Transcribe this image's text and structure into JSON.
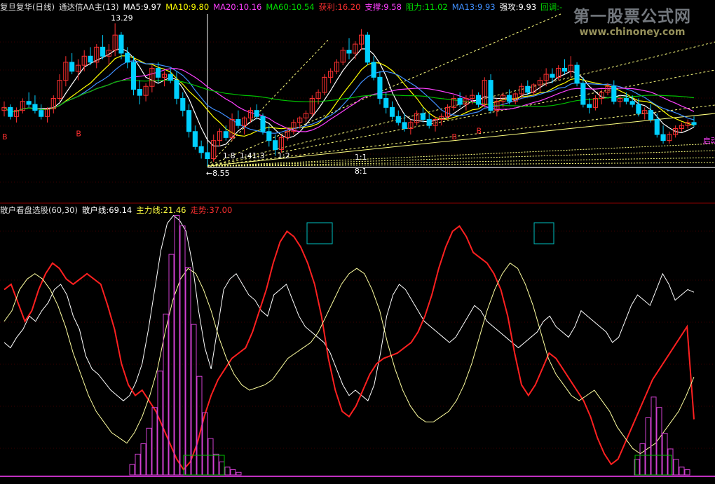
{
  "header_top": {
    "stock": "复旦复华(日线)",
    "indicator": "通达信AA主(13)",
    "ma5": "MA5:9.97",
    "ma10": "MA10:9.80",
    "ma20": "MA20:10.16",
    "ma60": "MA60:10.54",
    "profit": "获利:16.20",
    "support": "支撑:9.58",
    "resist": "阻力:11.02",
    "ma13": "MA13:9.93",
    "strong": "强攻:9.93",
    "pullback": "回调:-"
  },
  "header_bottom": {
    "name": "散户看盘选股(60,30)",
    "retail": "散户线:69.14",
    "main": "主力线:21.46",
    "trend": "走势:37.00"
  },
  "watermark": {
    "cn": "第一股票公式网",
    "url": "www.chinoney.com"
  },
  "colors": {
    "up": "#ff3030",
    "down": "#00d0ff",
    "yellow": "#ffff40",
    "ma5": "#ffffff",
    "ma10": "#ffff00",
    "ma20": "#ff40ff",
    "ma60": "#00c000",
    "retail": "#ffffff",
    "main": "#ff2020",
    "trend": "#ffffa0",
    "bar": "#d040d0",
    "box": "#00c0c0",
    "grid": "#8b0000"
  },
  "chart_data": [
    {
      "type": "candlestick",
      "title": "复旦复华(日线)",
      "ylim": [
        8.3,
        13.6
      ],
      "annotations": {
        "high": "13.29",
        "low": "8.55",
        "start_label": "启动",
        "b_label": "B"
      },
      "fib_labels": [
        "1:8",
        "1:4",
        "1:3",
        "1:2",
        "1:1",
        "8:1"
      ],
      "ohlc": [
        [
          10.4,
          10.7,
          10.2,
          10.5
        ],
        [
          10.5,
          10.6,
          10.1,
          10.2
        ],
        [
          10.2,
          10.5,
          10.0,
          10.4
        ],
        [
          10.4,
          10.8,
          10.3,
          10.7
        ],
        [
          10.7,
          11.0,
          10.5,
          10.6
        ],
        [
          10.6,
          10.9,
          10.3,
          10.4
        ],
        [
          10.4,
          10.6,
          10.1,
          10.2
        ],
        [
          10.2,
          10.5,
          10.0,
          10.45
        ],
        [
          10.45,
          10.9,
          10.3,
          10.8
        ],
        [
          10.8,
          11.6,
          10.7,
          11.4
        ],
        [
          11.4,
          12.2,
          11.2,
          12.0
        ],
        [
          12.0,
          12.3,
          11.6,
          11.7
        ],
        [
          11.7,
          12.1,
          11.4,
          11.9
        ],
        [
          11.9,
          12.4,
          11.7,
          12.2
        ],
        [
          12.2,
          12.5,
          11.9,
          12.0
        ],
        [
          12.0,
          12.6,
          11.8,
          12.5
        ],
        [
          12.5,
          12.9,
          12.1,
          12.2
        ],
        [
          12.2,
          12.6,
          11.9,
          12.4
        ],
        [
          12.4,
          13.29,
          12.2,
          12.9
        ],
        [
          12.9,
          13.0,
          12.1,
          12.3
        ],
        [
          12.3,
          12.5,
          11.8,
          12.0
        ],
        [
          12.0,
          12.2,
          10.9,
          11.1
        ],
        [
          11.1,
          11.4,
          10.6,
          10.9
        ],
        [
          10.9,
          11.3,
          10.7,
          11.2
        ],
        [
          11.2,
          11.9,
          11.0,
          11.8
        ],
        [
          11.8,
          12.0,
          11.3,
          11.5
        ],
        [
          11.5,
          11.7,
          11.2,
          11.6
        ],
        [
          11.6,
          11.8,
          11.3,
          11.4
        ],
        [
          11.4,
          11.7,
          10.6,
          10.8
        ],
        [
          10.8,
          11.0,
          10.2,
          10.4
        ],
        [
          10.4,
          10.6,
          9.5,
          9.7
        ],
        [
          9.7,
          9.9,
          9.1,
          9.2
        ],
        [
          9.2,
          9.4,
          8.8,
          9.0
        ],
        [
          9.0,
          9.3,
          8.55,
          8.8
        ],
        [
          8.8,
          9.6,
          8.7,
          9.4
        ],
        [
          9.4,
          9.8,
          9.2,
          9.7
        ],
        [
          9.7,
          9.9,
          9.4,
          9.5
        ],
        [
          9.5,
          10.3,
          9.4,
          10.1
        ],
        [
          10.1,
          10.4,
          9.8,
          9.9
        ],
        [
          9.9,
          10.2,
          9.6,
          10.15
        ],
        [
          10.15,
          10.5,
          10.0,
          10.4
        ],
        [
          10.4,
          10.6,
          10.1,
          10.2
        ],
        [
          10.2,
          10.3,
          9.6,
          9.7
        ],
        [
          9.7,
          9.9,
          9.2,
          9.4
        ],
        [
          9.4,
          9.6,
          8.9,
          9.1
        ],
        [
          9.1,
          9.6,
          9.0,
          9.5
        ],
        [
          9.5,
          9.8,
          9.4,
          9.7
        ],
        [
          9.7,
          10.1,
          9.6,
          10.0
        ],
        [
          10.0,
          10.2,
          9.8,
          10.15
        ],
        [
          10.15,
          10.4,
          10.0,
          10.3
        ],
        [
          10.3,
          10.9,
          10.2,
          10.8
        ],
        [
          10.8,
          11.1,
          10.6,
          11.0
        ],
        [
          11.0,
          11.6,
          10.9,
          11.5
        ],
        [
          11.5,
          11.8,
          11.3,
          11.7
        ],
        [
          11.7,
          12.1,
          11.6,
          12.0
        ],
        [
          12.0,
          12.5,
          11.9,
          12.4
        ],
        [
          12.4,
          12.8,
          12.1,
          12.3
        ],
        [
          12.3,
          12.7,
          12.1,
          12.6
        ],
        [
          12.6,
          13.1,
          12.4,
          12.9
        ],
        [
          12.9,
          13.0,
          11.9,
          12.0
        ],
        [
          12.0,
          12.2,
          11.4,
          11.5
        ],
        [
          11.5,
          11.7,
          10.6,
          10.8
        ],
        [
          10.8,
          11.0,
          10.3,
          10.5
        ],
        [
          10.5,
          10.7,
          10.1,
          10.2
        ],
        [
          10.2,
          10.4,
          9.9,
          10.0
        ],
        [
          10.0,
          10.3,
          9.7,
          9.8
        ],
        [
          9.8,
          10.1,
          9.6,
          10.0
        ],
        [
          10.0,
          10.4,
          9.9,
          10.3
        ],
        [
          10.3,
          10.5,
          10.0,
          10.1
        ],
        [
          10.1,
          10.3,
          9.8,
          9.9
        ],
        [
          9.9,
          10.2,
          9.7,
          10.1
        ],
        [
          10.1,
          10.3,
          9.9,
          10.2
        ],
        [
          10.2,
          10.6,
          10.1,
          10.5
        ],
        [
          10.5,
          10.9,
          10.4,
          10.8
        ],
        [
          10.8,
          11.0,
          10.5,
          10.6
        ],
        [
          10.6,
          10.9,
          10.4,
          10.8
        ],
        [
          10.8,
          11.1,
          10.6,
          10.9
        ],
        [
          10.9,
          11.0,
          10.5,
          10.6
        ],
        [
          10.6,
          11.5,
          10.5,
          11.4
        ],
        [
          11.4,
          11.6,
          10.3,
          10.4
        ],
        [
          10.4,
          10.8,
          10.2,
          10.7
        ],
        [
          10.7,
          11.0,
          10.5,
          10.9
        ],
        [
          10.9,
          11.1,
          10.6,
          10.7
        ],
        [
          10.7,
          11.0,
          10.6,
          10.95
        ],
        [
          10.95,
          11.3,
          10.8,
          11.2
        ],
        [
          11.2,
          11.4,
          10.9,
          11.0
        ],
        [
          11.0,
          11.3,
          10.9,
          11.25
        ],
        [
          11.25,
          11.5,
          11.0,
          11.4
        ],
        [
          11.4,
          11.8,
          11.2,
          11.6
        ],
        [
          11.6,
          11.8,
          11.3,
          11.5
        ],
        [
          11.5,
          11.9,
          11.4,
          11.8
        ],
        [
          11.8,
          12.1,
          11.6,
          11.7
        ],
        [
          11.7,
          12.2,
          11.5,
          11.9
        ],
        [
          11.9,
          12.0,
          11.2,
          11.3
        ],
        [
          11.3,
          11.5,
          10.5,
          10.6
        ],
        [
          10.6,
          10.8,
          10.3,
          10.5
        ],
        [
          10.5,
          10.9,
          10.4,
          10.8
        ],
        [
          10.8,
          11.1,
          10.6,
          11.0
        ],
        [
          11.0,
          11.3,
          10.9,
          11.2
        ],
        [
          11.2,
          11.4,
          10.6,
          10.7
        ],
        [
          10.7,
          10.9,
          10.5,
          10.8
        ],
        [
          10.8,
          11.0,
          10.6,
          10.7
        ],
        [
          10.7,
          10.9,
          10.5,
          10.6
        ],
        [
          10.6,
          10.8,
          10.2,
          10.3
        ],
        [
          10.3,
          10.5,
          10.1,
          10.4
        ],
        [
          10.4,
          10.6,
          10.0,
          10.1
        ],
        [
          10.1,
          10.3,
          9.5,
          9.6
        ],
        [
          9.6,
          9.9,
          9.3,
          9.4
        ],
        [
          9.4,
          9.7,
          9.3,
          9.6
        ],
        [
          9.6,
          9.9,
          9.5,
          9.8
        ],
        [
          9.8,
          10.0,
          9.7,
          9.9
        ],
        [
          9.9,
          10.1,
          9.8,
          10.0
        ],
        [
          10.0,
          10.2,
          9.85,
          9.93
        ]
      ]
    },
    {
      "type": "line",
      "title": "散户看盘选股(60,30)",
      "ylim": [
        0,
        100
      ],
      "series": [
        {
          "name": "散户线",
          "values": [
            50,
            48,
            52,
            55,
            60,
            58,
            62,
            65,
            70,
            72,
            68,
            60,
            55,
            45,
            40,
            38,
            35,
            32,
            30,
            28,
            30,
            35,
            42,
            55,
            70,
            85,
            95,
            98,
            96,
            92,
            80,
            62,
            48,
            40,
            55,
            70,
            74,
            76,
            72,
            68,
            66,
            62,
            60,
            68,
            70,
            72,
            66,
            60,
            56,
            54,
            52,
            50,
            46,
            40,
            34,
            30,
            32,
            30,
            28,
            34,
            46,
            60,
            68,
            72,
            70,
            66,
            62,
            58,
            56,
            54,
            52,
            50,
            52,
            56,
            60,
            64,
            62,
            58,
            56,
            54,
            52,
            50,
            48,
            50,
            52,
            54,
            58,
            60,
            56,
            54,
            52,
            56,
            62,
            60,
            58,
            56,
            54,
            50,
            52,
            58,
            64,
            68,
            66,
            64,
            70,
            76,
            72,
            66,
            68,
            70,
            69
          ]
        },
        {
          "name": "主力线",
          "values": [
            70,
            72,
            65,
            58,
            62,
            70,
            76,
            80,
            78,
            74,
            72,
            74,
            76,
            74,
            72,
            64,
            55,
            42,
            34,
            30,
            32,
            28,
            24,
            18,
            12,
            6,
            2,
            5,
            12,
            22,
            30,
            36,
            40,
            44,
            46,
            48,
            54,
            62,
            70,
            80,
            88,
            92,
            90,
            86,
            80,
            72,
            60,
            44,
            32,
            24,
            22,
            26,
            32,
            38,
            42,
            44,
            45,
            46,
            48,
            50,
            54,
            60,
            68,
            78,
            86,
            92,
            94,
            90,
            84,
            82,
            80,
            76,
            70,
            60,
            46,
            34,
            30,
            34,
            40,
            46,
            44,
            40,
            36,
            32,
            28,
            22,
            14,
            8,
            4,
            6,
            12,
            18,
            24,
            30,
            36,
            40,
            44,
            48,
            52,
            56,
            21
          ]
        },
        {
          "name": "走势",
          "values": [
            58,
            62,
            70,
            74,
            76,
            74,
            70,
            64,
            56,
            46,
            38,
            30,
            24,
            20,
            16,
            14,
            12,
            16,
            22,
            30,
            40,
            54,
            66,
            74,
            78,
            76,
            70,
            62,
            52,
            44,
            38,
            34,
            32,
            33,
            34,
            36,
            40,
            44,
            46,
            48,
            50,
            54,
            60,
            66,
            72,
            76,
            78,
            76,
            70,
            62,
            50,
            40,
            32,
            26,
            22,
            20,
            20,
            22,
            24,
            28,
            34,
            42,
            52,
            62,
            70,
            76,
            80,
            78,
            72,
            64,
            54,
            44,
            38,
            34,
            30,
            28,
            30,
            32,
            28,
            24,
            18,
            14,
            10,
            8,
            10,
            12,
            16,
            20,
            24,
            30,
            37
          ]
        }
      ],
      "bars_left": [
        4,
        8,
        12,
        18,
        26,
        40,
        62,
        85,
        100,
        96,
        80,
        58,
        38,
        24,
        14,
        8,
        5,
        3,
        2,
        1
      ],
      "bars_right": [
        6,
        12,
        22,
        30,
        26,
        16,
        10,
        6,
        3,
        2
      ]
    }
  ]
}
